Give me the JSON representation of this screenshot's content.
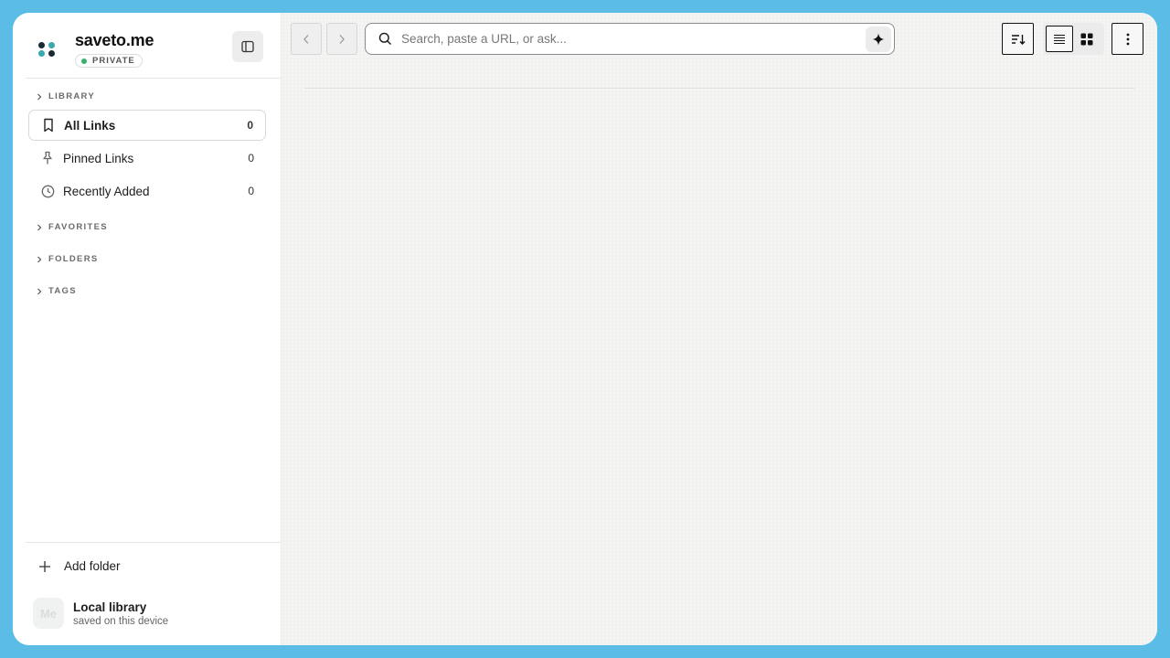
{
  "app": {
    "name": "saveto.me",
    "privacy_badge": "PRIVATE",
    "colors": {
      "frame": "#5bbde6",
      "accent": "#111111",
      "status_green": "#37b26c",
      "logo_dark": "#1a2a35",
      "logo_teal": "#3aa8b0"
    }
  },
  "sidebar": {
    "sections": [
      {
        "label": "LIBRARY"
      },
      {
        "label": "FAVORITES"
      },
      {
        "label": "FOLDERS"
      },
      {
        "label": "TAGS"
      }
    ],
    "items": [
      {
        "label": "All Links",
        "count": "0",
        "icon": "bookmark-icon",
        "active": true
      },
      {
        "label": "Pinned Links",
        "count": "0",
        "icon": "pin-icon",
        "active": false
      },
      {
        "label": "Recently Added",
        "count": "0",
        "icon": "clock-icon",
        "active": false
      }
    ],
    "add_folder_label": "Add folder",
    "user": {
      "initials": "Me",
      "name": "Local library",
      "subtitle": "saved on this device"
    }
  },
  "toolbar": {
    "search_placeholder": "Search, paste a URL, or ask...",
    "search_value": "",
    "view_mode": "list"
  }
}
